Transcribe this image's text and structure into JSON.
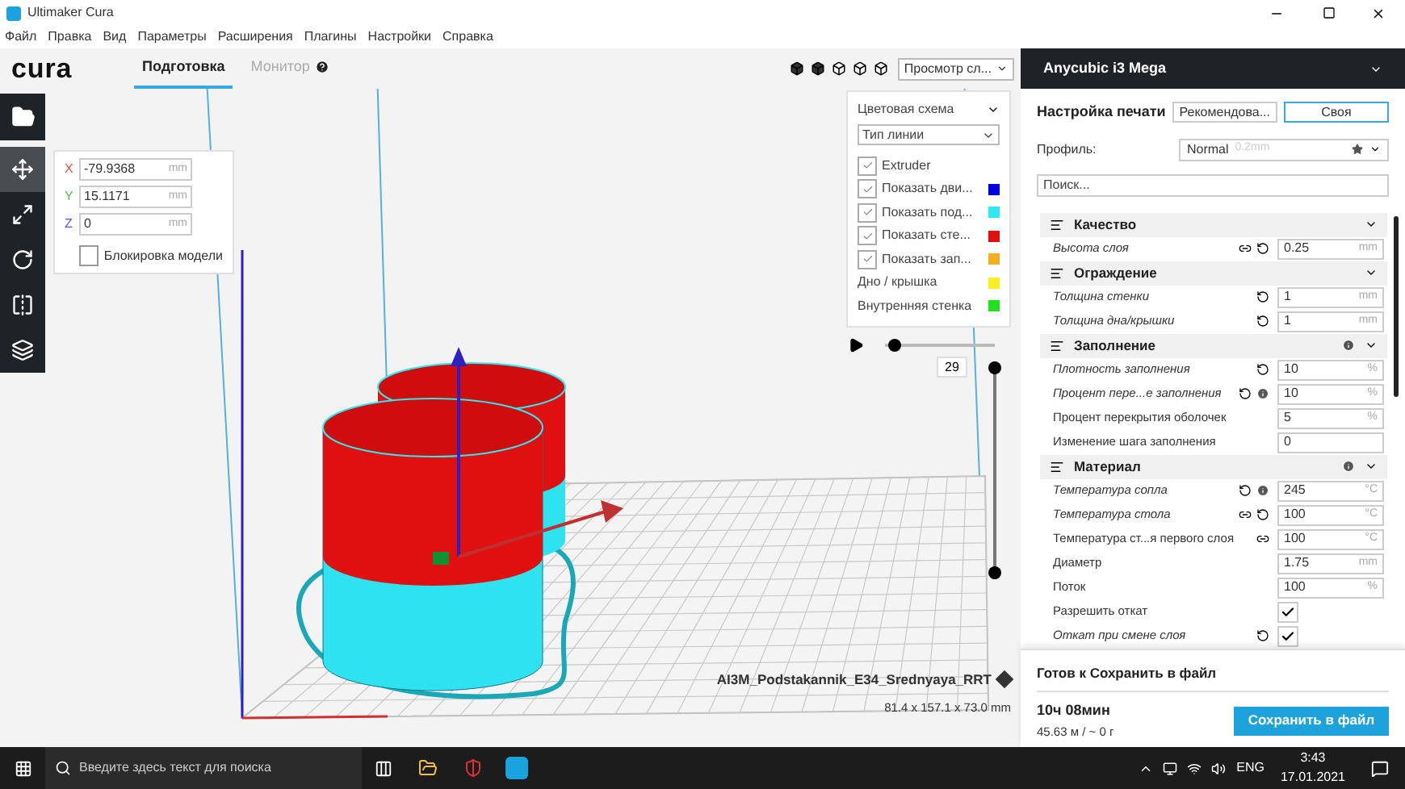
{
  "window": {
    "title": "Ultimaker Cura"
  },
  "menu": [
    "Файл",
    "Правка",
    "Вид",
    "Параметры",
    "Расширения",
    "Плагины",
    "Настройки",
    "Справка"
  ],
  "header": {
    "logo": "cura",
    "tabs": [
      {
        "label": "Подготовка",
        "selected": true
      },
      {
        "label": "Монитор",
        "selected": false
      }
    ],
    "view_dropdown": "Просмотр сл...",
    "printer": "Anycubic i3 Mega"
  },
  "move_panel": {
    "fields": [
      {
        "axis": "X",
        "value": "-79.9368",
        "unit": "mm",
        "color": "#e05050"
      },
      {
        "axis": "Y",
        "value": "15.1171",
        "unit": "mm",
        "color": "#50c050"
      },
      {
        "axis": "Z",
        "value": "0",
        "unit": "mm",
        "color": "#5050e0"
      }
    ],
    "lock": {
      "label": "Блокировка модели",
      "checked": false
    }
  },
  "layer_view": {
    "title": "Цветовая схема",
    "scheme": "Тип линии",
    "items": [
      {
        "kind": "check",
        "label": "Extruder",
        "checked": true
      },
      {
        "kind": "check",
        "label": "Показать дви...",
        "checked": true,
        "color": "#0000e0"
      },
      {
        "kind": "check",
        "label": "Показать под...",
        "checked": true,
        "color": "#30e8f0"
      },
      {
        "kind": "check",
        "label": "Показать сте...",
        "checked": true,
        "color": "#e01010"
      },
      {
        "kind": "check",
        "label": "Показать зап...",
        "checked": true,
        "color": "#f0b020"
      },
      {
        "kind": "legend",
        "label": "Дно / крышка",
        "color": "#f8f020"
      },
      {
        "kind": "legend",
        "label": "Внутренняя стенка",
        "color": "#20e020"
      }
    ]
  },
  "layer_slider": {
    "playing": false,
    "horizontal": {
      "level": 0.03
    },
    "vertical": {
      "level": 1,
      "reading": "29"
    }
  },
  "model": {
    "name": "AI3M_Podstakannik_E34_Srednyaya_RRT",
    "size": "81.4 x 157.1 x 73.0 mm"
  },
  "print_setup": {
    "title": "Настройка печати",
    "modes": [
      {
        "label": "Рекомендова...",
        "selected": false
      },
      {
        "label": "Своя",
        "selected": true
      }
    ],
    "profile_label": "Профиль:",
    "profile": "Normal",
    "profile_detail": "0.2mm",
    "search": {
      "placeholder": "Поиск..."
    },
    "settings": [
      {
        "kind": "section",
        "label": "Качество"
      },
      {
        "kind": "value",
        "label": "Высота слоя",
        "modified": true,
        "linked": true,
        "reset": true,
        "value": "0.25",
        "unit": "mm"
      },
      {
        "kind": "section",
        "label": "Ограждение"
      },
      {
        "kind": "value",
        "label": "Толщина стенки",
        "modified": true,
        "reset": true,
        "value": "1",
        "unit": "mm"
      },
      {
        "kind": "value",
        "label": "Толщина дна/крышки",
        "modified": true,
        "reset": true,
        "value": "1",
        "unit": "mm"
      },
      {
        "kind": "section",
        "label": "Заполнение",
        "info": true
      },
      {
        "kind": "value",
        "label": "Плотность заполнения",
        "modified": true,
        "reset": true,
        "value": "10",
        "unit": "%"
      },
      {
        "kind": "value",
        "label": "Процент пере...е заполнения",
        "modified": true,
        "reset": true,
        "info": true,
        "value": "10",
        "unit": "%"
      },
      {
        "kind": "value",
        "label": "Процент перекрытия оболочек",
        "modified": false,
        "value": "5",
        "unit": "%"
      },
      {
        "kind": "value",
        "label": "Изменение шага заполнения",
        "modified": false,
        "value": "0"
      },
      {
        "kind": "section",
        "label": "Материал",
        "info": true
      },
      {
        "kind": "value",
        "label": "Температура сопла",
        "modified": true,
        "reset": true,
        "info": true,
        "value": "245",
        "unit": "°C"
      },
      {
        "kind": "value",
        "label": "Температура стола",
        "modified": true,
        "linked": true,
        "reset": true,
        "value": "100",
        "unit": "°C"
      },
      {
        "kind": "value",
        "label": "Температура ст...я первого слоя",
        "modified": false,
        "linked": true,
        "value": "100",
        "unit": "°C"
      },
      {
        "kind": "value",
        "label": "Диаметр",
        "modified": false,
        "value": "1.75",
        "unit": "mm"
      },
      {
        "kind": "value",
        "label": "Поток",
        "modified": false,
        "value": "100",
        "unit": "%"
      },
      {
        "kind": "check",
        "label": "Разрешить откат",
        "modified": false,
        "checked": true
      },
      {
        "kind": "check",
        "label": "Откат при смене слоя",
        "modified": true,
        "reset": true,
        "checked": true
      }
    ]
  },
  "footer": {
    "status": "Готов к Сохранить в файл",
    "time": "10ч 08мин",
    "material": "45.63 м / ~ 0 г",
    "button": "Сохранить в файл"
  },
  "taskbar": {
    "search": {
      "placeholder": "Введите здесь текст для поиска"
    },
    "language": "ENG",
    "time": "3:43",
    "date": "17.01.2021"
  }
}
